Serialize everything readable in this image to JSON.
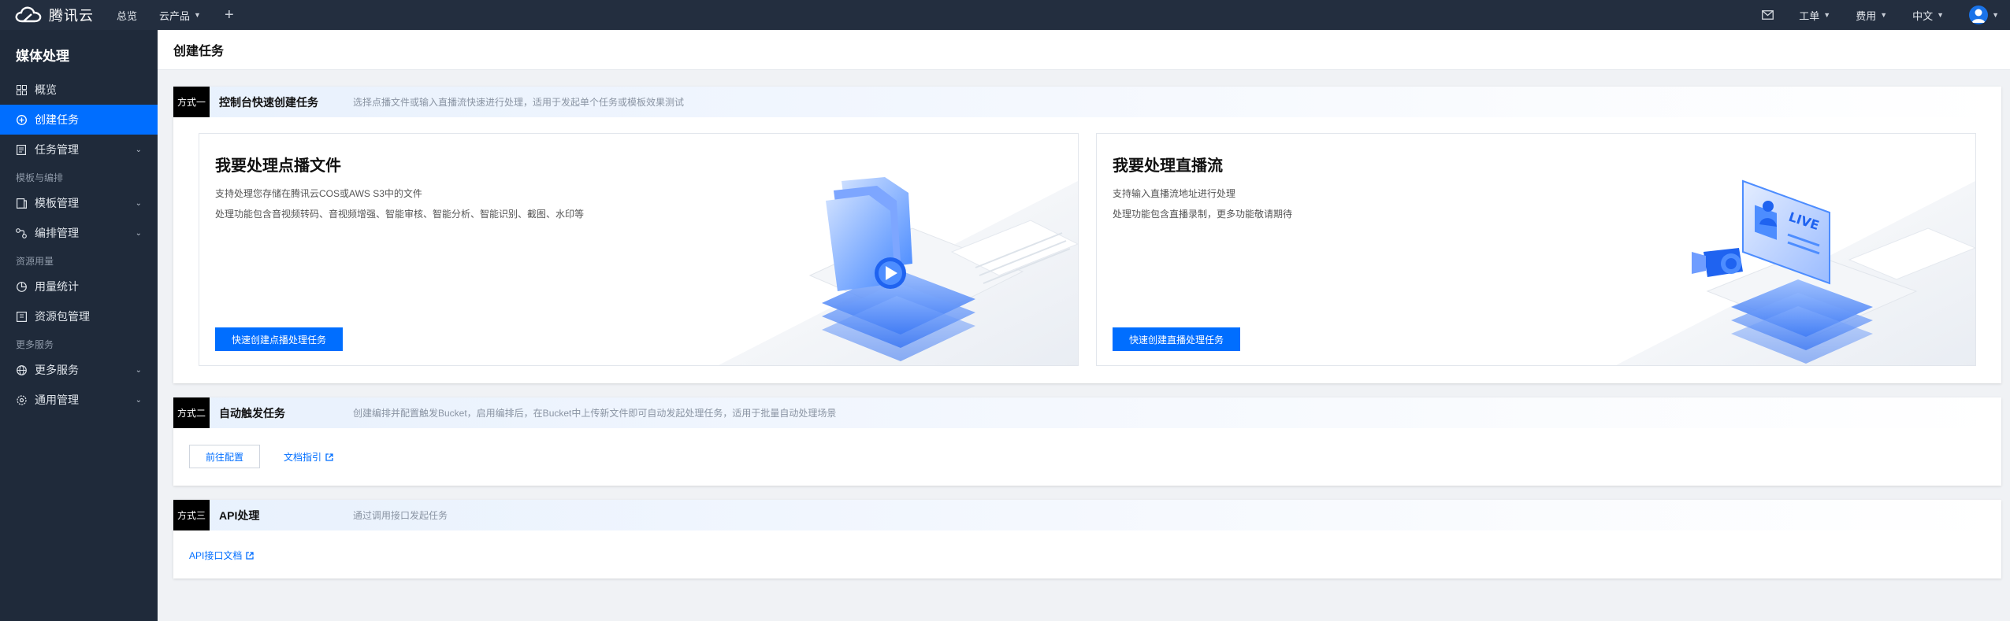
{
  "topbar": {
    "brand": "腾讯云",
    "nav": {
      "overview": "总览",
      "products": "云产品",
      "add": "+"
    },
    "right": {
      "ticket": "工单",
      "billing": "费用",
      "language": "中文"
    }
  },
  "sidebar": {
    "title": "媒体处理",
    "items": {
      "overview": "概览",
      "create_task": "创建任务",
      "task_manage": "任务管理",
      "group_template": "模板与编排",
      "template_manage": "模板管理",
      "orchestration_manage": "编排管理",
      "group_usage": "资源用量",
      "usage_stats": "用量统计",
      "package_manage": "资源包管理",
      "group_more": "更多服务",
      "more_services": "更多服务",
      "general_manage": "通用管理"
    }
  },
  "page": {
    "title": "创建任务"
  },
  "method1": {
    "tag": "方式一",
    "title": "控制台快速创建任务",
    "desc": "选择点播文件或输入直播流快速进行处理，适用于发起单个任务或模板效果测试",
    "vod": {
      "title": "我要处理点播文件",
      "line1": "支持处理您存储在腾讯云COS或AWS S3中的文件",
      "line2": "处理功能包含音视频转码、音视频增强、智能审核、智能分析、智能识别、截图、水印等",
      "button": "快速创建点播处理任务"
    },
    "live": {
      "title": "我要处理直播流",
      "line1": "支持输入直播流地址进行处理",
      "line2": "处理功能包含直播录制，更多功能敬请期待",
      "button": "快速创建直播处理任务"
    }
  },
  "method2": {
    "tag": "方式二",
    "title": "自动触发任务",
    "desc": "创建编排并配置触发Bucket，启用编排后，在Bucket中上传新文件即可自动发起处理任务，适用于批量自动处理场景",
    "config_button": "前往配置",
    "doc_link": "文档指引"
  },
  "method3": {
    "tag": "方式三",
    "title": "API处理",
    "desc": "通过调用接口发起任务",
    "api_link": "API接口文档"
  },
  "colors": {
    "accent": "#006eff",
    "topbar": "#232e3f",
    "sidebar": "#1f2a3a"
  },
  "icons": [
    "cloud-logo-icon",
    "mail-icon",
    "user-avatar-icon",
    "grid-icon",
    "plus-circle-icon",
    "document-icon",
    "template-icon",
    "orchestration-icon",
    "pie-chart-icon",
    "package-icon",
    "globe-icon",
    "gear-icon",
    "external-link-icon"
  ]
}
